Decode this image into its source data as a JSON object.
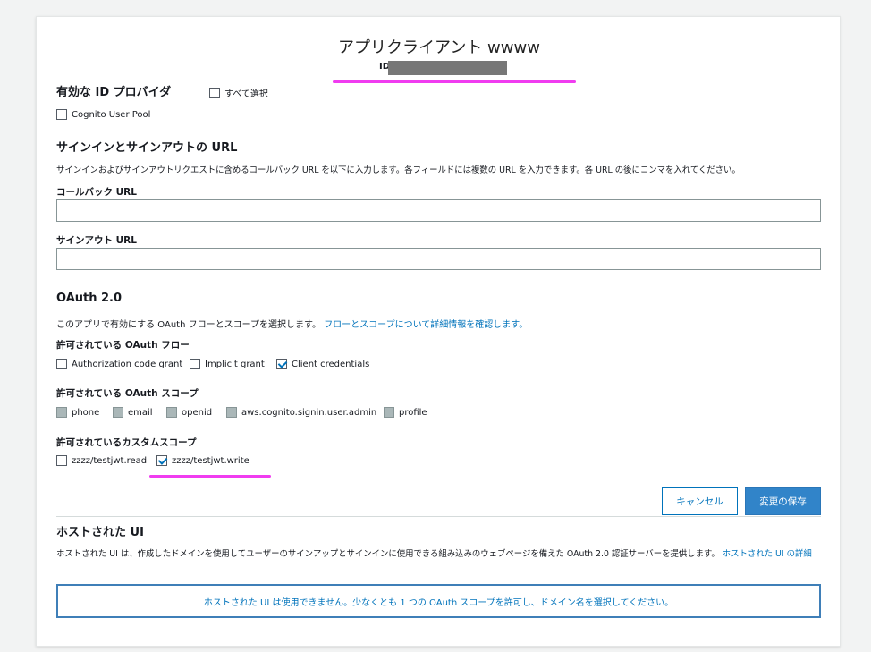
{
  "header": {
    "title": "アプリクライアント wwww",
    "id_label": "ID"
  },
  "idp": {
    "heading": "有効な ID プロバイダ",
    "select_all": "すべて選択",
    "cognito_user_pool": "Cognito User Pool"
  },
  "signin": {
    "heading": "サインインとサインアウトの URL",
    "description": "サインインおよびサインアウトリクエストに含めるコールバック URL を以下に入力します。各フィールドには複数の URL を入力できます。各 URL の後にコンマを入れてください。",
    "callback_label": "コールバック URL",
    "callback_value": "",
    "signout_label": "サインアウト URL",
    "signout_value": ""
  },
  "oauth": {
    "heading": "OAuth 2.0",
    "description": "このアプリで有効にする OAuth フローとスコープを選択します。",
    "description_link": "フローとスコープについて詳細情報を確認します。",
    "flows_label": "許可されている OAuth フロー",
    "flows": [
      {
        "label": "Authorization code grant",
        "checked": false
      },
      {
        "label": "Implicit grant",
        "checked": false
      },
      {
        "label": "Client credentials",
        "checked": true
      }
    ],
    "scopes_label": "許可されている OAuth スコープ",
    "scopes": [
      "phone",
      "email",
      "openid",
      "aws.cognito.signin.user.admin",
      "profile"
    ],
    "custom_label": "許可されているカスタムスコープ",
    "custom_scopes": [
      {
        "label": "zzzz/testjwt.read",
        "checked": false
      },
      {
        "label": "zzzz/testjwt.write",
        "checked": true
      }
    ]
  },
  "actions": {
    "cancel": "キャンセル",
    "save": "変更の保存"
  },
  "hosted_ui": {
    "heading": "ホストされた UI",
    "description_1": "ホストされた UI は、作成したドメインを使用してユーザーのサインアップとサインインに使用できる組み込みのウェブページを備えた OAuth 2.0 認証サーバーを提供します。",
    "link_1": "ホス",
    "link_2": "トされた UI の詳細",
    "notice": "ホストされた UI は使用できません。少なくとも 1 つの OAuth スコープを許可し、ドメイン名を選択してください。"
  },
  "colors": {
    "accent": "#0073bb",
    "annotation_pink": "#f03cf0",
    "primary_button": "#3184c9"
  }
}
